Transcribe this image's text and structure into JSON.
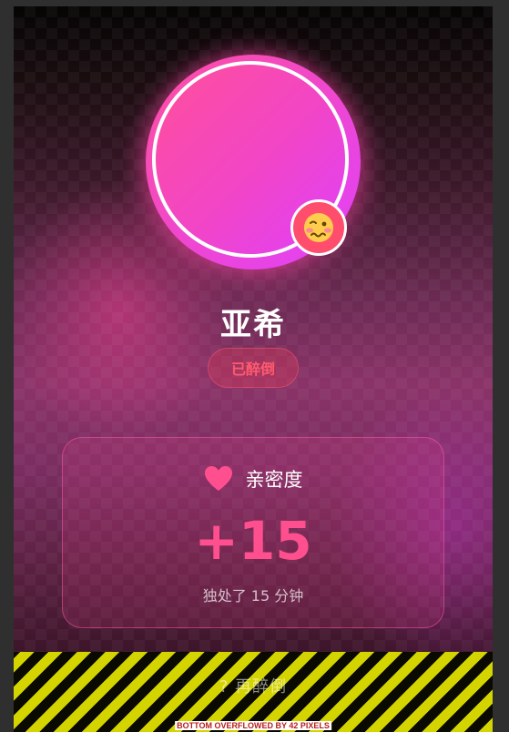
{
  "profile": {
    "name": "亚希",
    "status": "已醉倒",
    "mood_icon": "woozy-face-icon"
  },
  "intimacy": {
    "icon": "heart-icon",
    "title": "亲密度",
    "value": "+15",
    "subtitle": "独处了 15 分钟"
  },
  "hidden_action": {
    "label": "? 再醉倒"
  },
  "debug": {
    "overflow_label": "BOTTOM OVERFLOWED BY 42 PIXELS"
  },
  "colors": {
    "accent_pink": "#ff4f8e",
    "status_red": "#ff5a6e",
    "avatar_gradient_start": "#ff4f9a",
    "avatar_gradient_end": "#e040fb",
    "overflow_stripe": "#d4d400"
  }
}
